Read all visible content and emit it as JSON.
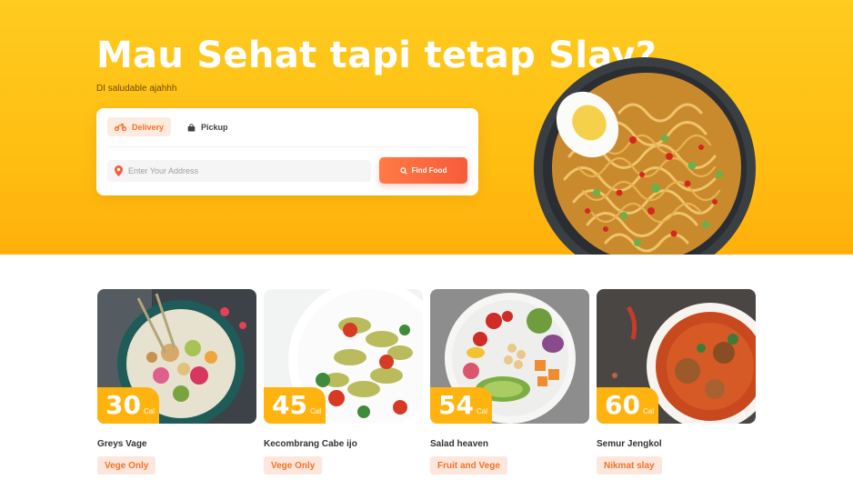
{
  "hero": {
    "title": "Mau Sehat tapi tetap Slay?",
    "subtitle": "DI saludable ajahhh"
  },
  "search": {
    "tabs": [
      {
        "label": "Delivery",
        "icon": "motorbike-icon",
        "active": true
      },
      {
        "label": "Pickup",
        "icon": "shopping-bag-icon",
        "active": false
      }
    ],
    "address_placeholder": "Enter Your Address",
    "address_value": "",
    "address_icon": "location-pin-icon",
    "find_button_label": "Find Food",
    "find_button_icon": "search-icon"
  },
  "foods": [
    {
      "calories": "30",
      "unit": "Cal",
      "name": "Greys Vage",
      "tag": "Vege Only"
    },
    {
      "calories": "45",
      "unit": "Cal",
      "name": "Kecombrang Cabe ijo",
      "tag": "Vege Only"
    },
    {
      "calories": "54",
      "unit": "Cal",
      "name": "Salad heaven",
      "tag": "Fruit and Vege"
    },
    {
      "calories": "60",
      "unit": "Cal",
      "name": "Semur Jengkol",
      "tag": "Nikmat slay"
    }
  ],
  "colors": {
    "hero_yellow": "#ffc01a",
    "accent_orange": "#f17228",
    "badge_yellow": "#ffb30e",
    "tag_bg": "#fde7dc"
  }
}
